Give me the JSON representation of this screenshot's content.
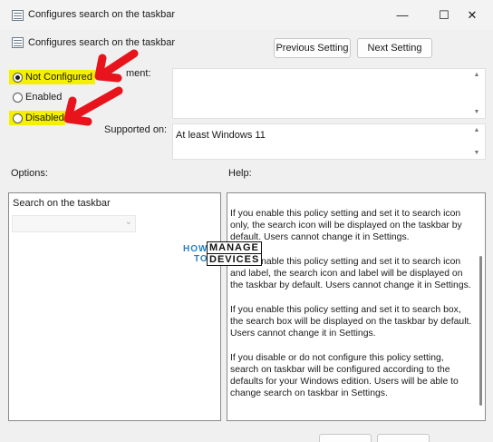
{
  "window": {
    "title": "Configures search on the taskbar",
    "icon": "policy-icon",
    "controls": {
      "minimize": "—",
      "maximize": "☐",
      "close": "✕"
    }
  },
  "header": {
    "setting_name": "Configures search on the taskbar",
    "previous_label": "Previous Setting",
    "next_label": "Next Setting"
  },
  "state": {
    "options": [
      {
        "label": "Not Configured",
        "selected": true,
        "highlighted": true
      },
      {
        "label": "Enabled",
        "selected": false,
        "highlighted": false
      },
      {
        "label": "Disabled",
        "selected": false,
        "highlighted": true
      }
    ]
  },
  "comment": {
    "label_partial": "ment:",
    "value": ""
  },
  "supported": {
    "label": "Supported on:",
    "value": "At least Windows 11"
  },
  "options_section": {
    "label": "Options:",
    "field_label": "Search on the taskbar",
    "dropdown_value": ""
  },
  "help_section": {
    "label": "Help:",
    "paragraphs": [
      [
        "If you enable this policy setting and set it to search icon",
        "only, the search icon will be displayed on the taskbar by",
        "default. Users cannot change it in Settings."
      ],
      [
        "If you enable this policy setting and set it to search icon",
        "and label, the search icon and label will be displayed on",
        "the taskbar by default. Users cannot change it in Settings."
      ],
      [
        "If you enable this policy setting and set it to search box,",
        "the search box will be displayed on the taskbar by default.",
        "Users cannot change it in Settings."
      ],
      [
        "If you disable or do not configure this policy setting,",
        "search on taskbar will be configured according to the",
        "defaults for your Windows edition. Users will be able to",
        "change search on taskbar in Settings."
      ]
    ]
  },
  "watermark": {
    "line1": "HOW",
    "line2": "TO",
    "word1": "MANAGE",
    "word2": "DEVICES"
  },
  "colors": {
    "highlight": "#f5ef00",
    "arrow": "#e8141c"
  }
}
